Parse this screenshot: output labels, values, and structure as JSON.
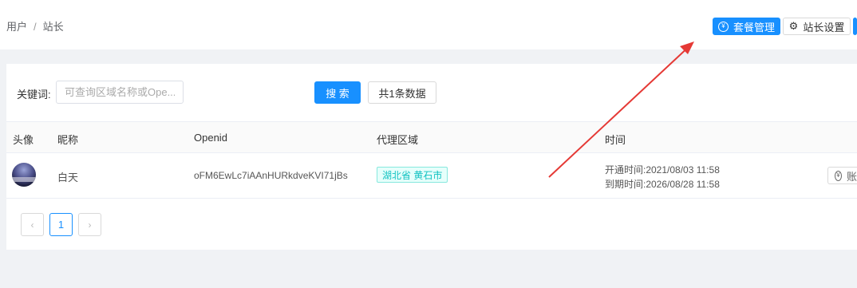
{
  "breadcrumb": {
    "parent": "用户",
    "separator": "/",
    "current": "站长"
  },
  "header_buttons": {
    "package_manage": {
      "label": "套餐管理",
      "icon": "yen-circle-icon"
    },
    "site_settings": {
      "label": "站长设置",
      "icon": "gear-icon"
    }
  },
  "search": {
    "label": "关键词:",
    "placeholder": "可查询区域名称或Ope...",
    "value": "",
    "search_button": "搜 索",
    "count_button": "共1条数据"
  },
  "table": {
    "headers": [
      "头像",
      "昵称",
      "Openid",
      "代理区域",
      "时间"
    ],
    "rows": [
      {
        "nickname": "白天",
        "openid": "oFM6EwLc7iAAnHURkdveKVI71jBs",
        "region": "湖北省 黄石市",
        "open_time": "开通时间:2021/08/03 11:58",
        "expire_time": "到期时间:2026/08/28 11:58",
        "action_label": "账"
      }
    ]
  },
  "pagination": {
    "prev": "‹",
    "current_page": "1",
    "next": "›"
  },
  "colors": {
    "primary": "#1890ff",
    "tag_text": "#13c2c2",
    "annotation_arrow": "#e53935"
  }
}
